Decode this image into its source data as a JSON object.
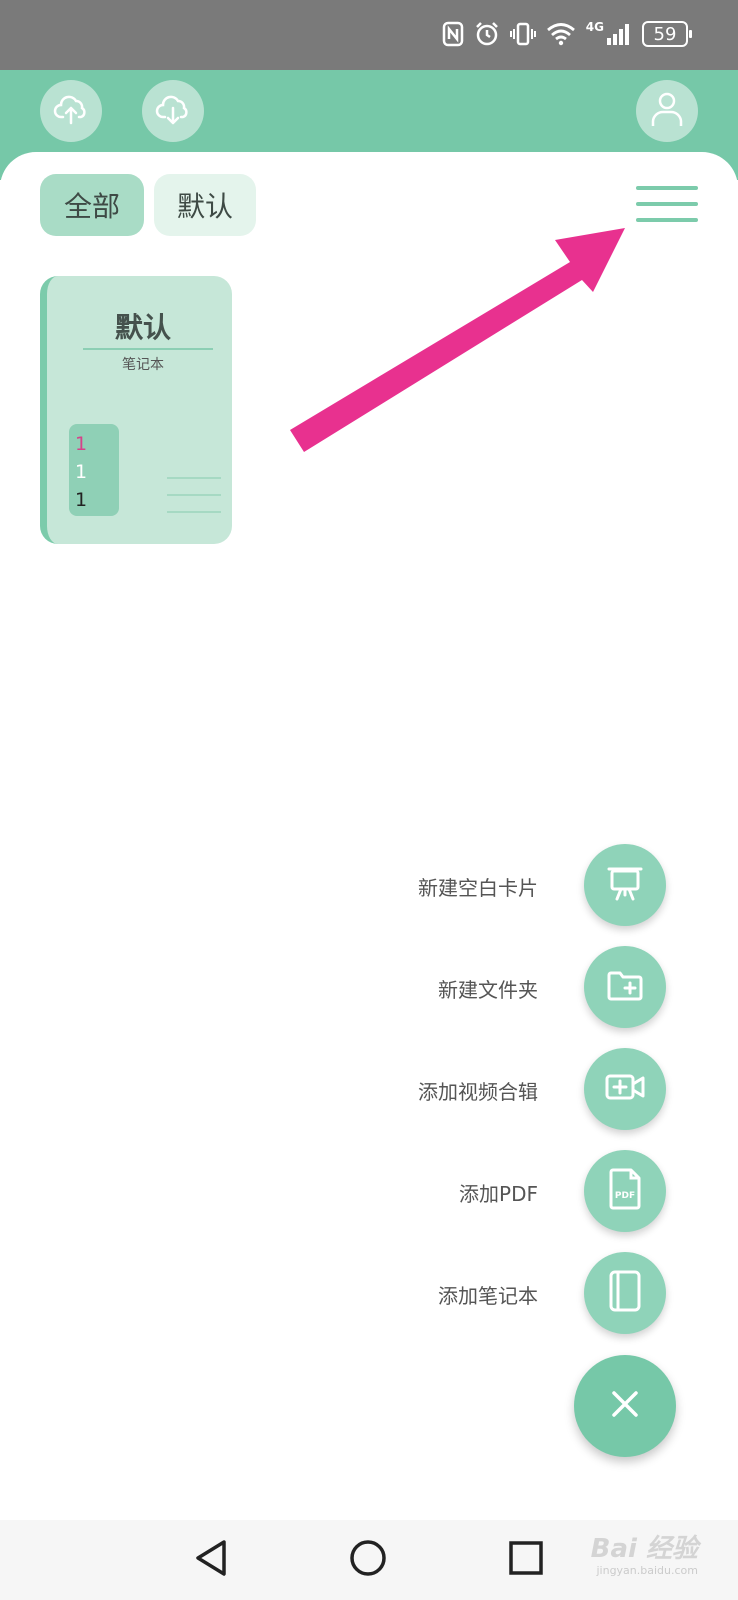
{
  "status_bar": {
    "network": "4G",
    "battery": "59",
    "icons": [
      "nfc-icon",
      "alarm-icon",
      "vibrate-icon",
      "wifi-icon",
      "signal-icon",
      "battery-icon"
    ]
  },
  "header": {
    "icons": [
      "cloud-upload-icon",
      "cloud-download-icon",
      "user-avatar-icon"
    ]
  },
  "tabs": [
    {
      "label": "全部",
      "selected": true
    },
    {
      "label": "默认",
      "selected": false
    }
  ],
  "notebook": {
    "title": "默认",
    "subtitle": "笔记本",
    "preview_lines": [
      "1",
      "1",
      "1"
    ]
  },
  "fab_menu": [
    {
      "label": "新建空白卡片",
      "icon": "easel-icon"
    },
    {
      "label": "新建文件夹",
      "icon": "folder-add-icon"
    },
    {
      "label": "添加视频合辑",
      "icon": "video-add-icon"
    },
    {
      "label": "添加PDF",
      "icon": "pdf-file-icon"
    },
    {
      "label": "添加笔记本",
      "icon": "notebook-icon"
    }
  ],
  "fab_close_icon": "close-icon",
  "nav": [
    "back-icon",
    "home-icon",
    "recents-icon"
  ],
  "watermark": {
    "text": "Bai 经验",
    "sub": "jingyan.baidu.com"
  },
  "colors": {
    "accent": "#76c8a8",
    "accent_light": "#b9e2d2",
    "arrow": "#e8318f",
    "status_bar": "#7a7a7a"
  }
}
